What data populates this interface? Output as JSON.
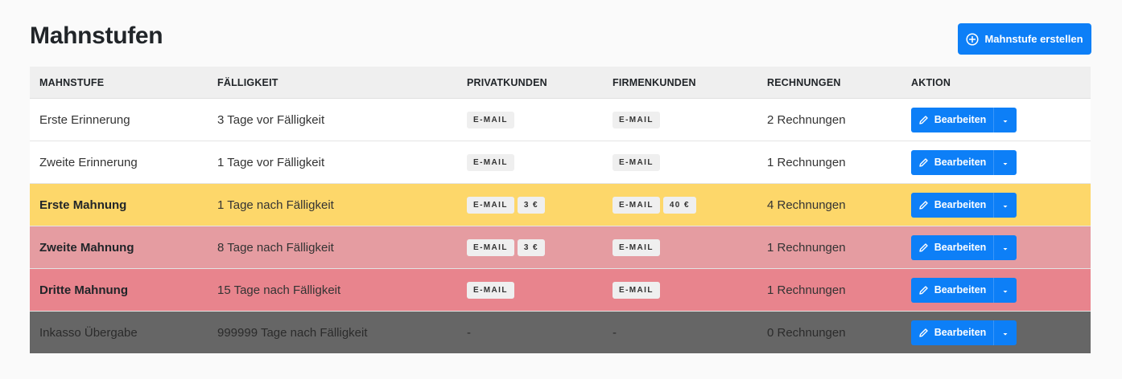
{
  "page": {
    "title": "Mahnstufen",
    "create_button_label": "Mahnstufe erstellen"
  },
  "table": {
    "headers": [
      "MAHNSTUFE",
      "FÄLLIGKEIT",
      "PRIVATKUNDEN",
      "FIRMENKUNDEN",
      "RECHNUNGEN",
      "AKTION"
    ],
    "rows": [
      {
        "name": "Erste Erinnerung",
        "due": "3 Tage vor Fälligkeit",
        "private": [
          "E-MAIL"
        ],
        "business": [
          "E-MAIL"
        ],
        "invoices": "2 Rechnungen",
        "action": "Bearbeiten",
        "bg": "#ffffff"
      },
      {
        "name": "Zweite Erinnerung",
        "due": "1 Tage vor Fälligkeit",
        "private": [
          "E-MAIL"
        ],
        "business": [
          "E-MAIL"
        ],
        "invoices": "1 Rechnungen",
        "action": "Bearbeiten",
        "bg": "#ffffff"
      },
      {
        "name": "Erste Mahnung",
        "due": "1 Tage nach Fälligkeit",
        "private": [
          "E-MAIL",
          "3 €"
        ],
        "business": [
          "E-MAIL",
          "40 €"
        ],
        "invoices": "4 Rechnungen",
        "action": "Bearbeiten",
        "bg": "#fdd76a"
      },
      {
        "name": "Zweite Mahnung",
        "due": "8 Tage nach Fälligkeit",
        "private": [
          "E-MAIL",
          "3 €"
        ],
        "business": [
          "E-MAIL"
        ],
        "invoices": "1 Rechnungen",
        "action": "Bearbeiten",
        "bg": "#e59ca1"
      },
      {
        "name": "Dritte Mahnung",
        "due": "15 Tage nach Fälligkeit",
        "private": [
          "E-MAIL"
        ],
        "business": [
          "E-MAIL"
        ],
        "invoices": "1 Rechnungen",
        "action": "Bearbeiten",
        "bg": "#e8848d"
      },
      {
        "name": "Inkasso Übergabe",
        "due": "999999 Tage nach Fälligkeit",
        "private_text": "-",
        "business_text": "-",
        "invoices": "0 Rechnungen",
        "action": "Bearbeiten",
        "bg": "#666666"
      }
    ]
  },
  "colors": {
    "primary": "#0d7ff7",
    "header_bg": "#efefef",
    "badge_bg": "#efefef"
  },
  "icons": {
    "create": "plus-circle-icon",
    "edit": "pencil-icon",
    "dropdown": "caret-down-icon"
  }
}
